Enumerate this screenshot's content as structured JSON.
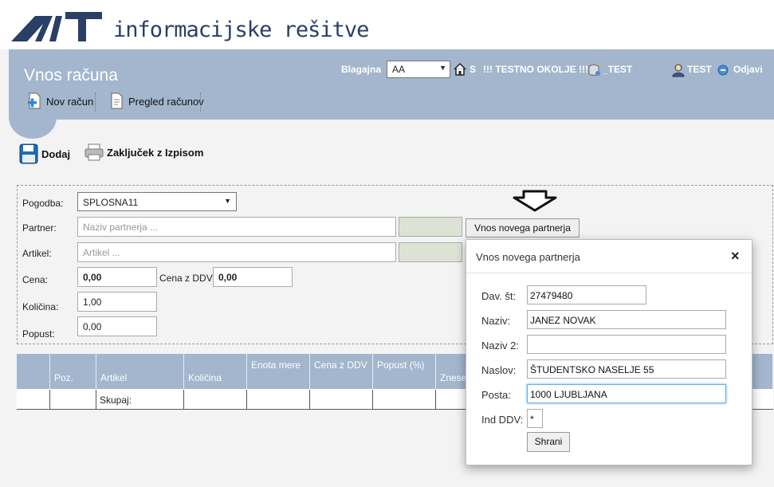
{
  "header": {
    "logo_text": "informacijske rešitve",
    "page_title": "Vnos računa",
    "nav": [
      {
        "label": "Nov račun",
        "icon": "new-document-icon"
      },
      {
        "label": "Pregled računov",
        "icon": "document-list-icon"
      }
    ],
    "blagajna_label": "Blagajna",
    "blagajna_value": "AA",
    "home_label": "S",
    "environment_label": "!!! TESTNO OKOLJE !!!",
    "db_label": "_TEST",
    "user_label": "TEST",
    "logout_label": "Odjavi"
  },
  "toolbar": {
    "add_label": "Dodaj",
    "close_label": "Zaključek z Izpisom"
  },
  "form": {
    "pogodba_label": "Pogodba:",
    "pogodba_value": "SPLOSNA11",
    "partner_label": "Partner:",
    "partner_placeholder": "Naziv partnerja ...",
    "new_partner_button": "Vnos novega partnerja",
    "artikel_label": "Artikel:",
    "artikel_placeholder": "Artikel ...",
    "cena_label": "Cena:",
    "cena_value": "0,00",
    "cena_ddv_label": "Cena z DDV:",
    "cena_ddv_value": "0,00",
    "kolicina_label": "Količina:",
    "kolicina_value": "1,00",
    "popust_label": "Popust:",
    "popust_value": "0,00"
  },
  "table": {
    "headers": [
      "",
      "Poz.",
      "Artikel",
      "Količina",
      "Enota mere",
      "Cena z DDV",
      "Popust (%)",
      "Znesek"
    ],
    "sum_label": "Skupaj:"
  },
  "dialog": {
    "title": "Vnos novega partnerja",
    "close": "×",
    "fields": [
      {
        "label": "Dav. št:",
        "value": "27479480"
      },
      {
        "label": "Naziv:",
        "value": "JANEZ NOVAK"
      },
      {
        "label": "Naziv 2:",
        "value": ""
      },
      {
        "label": "Naslov:",
        "value": "ŠTUDENTSKO NASELJE 55"
      },
      {
        "label": "Posta:",
        "value": "1000 LJUBLJANA"
      },
      {
        "label": "Ind DDV:",
        "value": "*"
      }
    ],
    "save_button": "Shrani"
  },
  "colors": {
    "banner": "#a3b6ce",
    "logo": "#2a3f66"
  }
}
